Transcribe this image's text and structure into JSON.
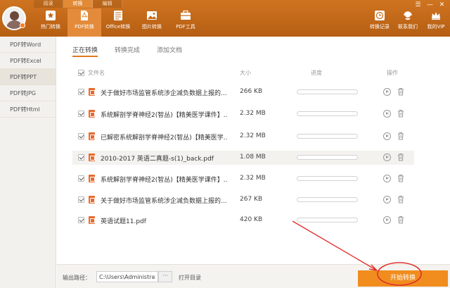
{
  "header": {
    "top_tabs": [
      {
        "label": "阅读"
      },
      {
        "label": "转换"
      },
      {
        "label": "编辑"
      }
    ],
    "nav": [
      {
        "label": "热门转换"
      },
      {
        "label": "PDF转换"
      },
      {
        "label": "Office转换"
      },
      {
        "label": "图片转换"
      },
      {
        "label": "PDF工具"
      }
    ],
    "right_nav": [
      {
        "label": "转换记录"
      },
      {
        "label": "联系我们"
      },
      {
        "label": "我的VIP"
      }
    ],
    "window_controls": [
      "☰",
      "—",
      "✕"
    ]
  },
  "sidebar": {
    "items": [
      {
        "label": "PDF转Word"
      },
      {
        "label": "PDF转Excel"
      },
      {
        "label": "PDF转PPT"
      },
      {
        "label": "PDF转JPG"
      },
      {
        "label": "PDF转Html"
      }
    ]
  },
  "subtabs": [
    {
      "label": "正在转换"
    },
    {
      "label": "转换完成"
    },
    {
      "label": "添加文档"
    }
  ],
  "table": {
    "headers": {
      "name": "文件名",
      "size": "大小",
      "progress": "进度",
      "action": "操作"
    },
    "rows": [
      {
        "name": "关于做好市场监管系统涉企减负数据上报的...",
        "size": "266 KB",
        "progress": 0
      },
      {
        "name": "系统解剖学脊神经2(智丛)【精美医学课件】...",
        "size": "2.32 MB",
        "progress": 0
      },
      {
        "name": "已解密系统解剖学脊神经2(智丛)【精美医学...",
        "size": "2.32 MB",
        "progress": 0
      },
      {
        "name": "2010-2017 英语二真题-s(1)_back.pdf",
        "size": "1.08 MB",
        "progress": 0
      },
      {
        "name": "系统解剖学脊神经2(智丛)【精美医学课件】...",
        "size": "2.32 MB",
        "progress": 0
      },
      {
        "name": "关于做好市场监管系统涉企减负数据上报的...",
        "size": "267 KB",
        "progress": 0
      },
      {
        "name": "英语试题11.pdf",
        "size": "420 KB",
        "progress": 0
      }
    ]
  },
  "footer": {
    "output_label": "输出路径：",
    "path_value": "C:\\Users\\Administrator",
    "browse_label": "···",
    "open_dir_label": "打开目录",
    "start_label": "开始转换"
  },
  "colors": {
    "header": "#c46a1a",
    "accent": "#f08d1e",
    "annotation": "#e0302a"
  }
}
